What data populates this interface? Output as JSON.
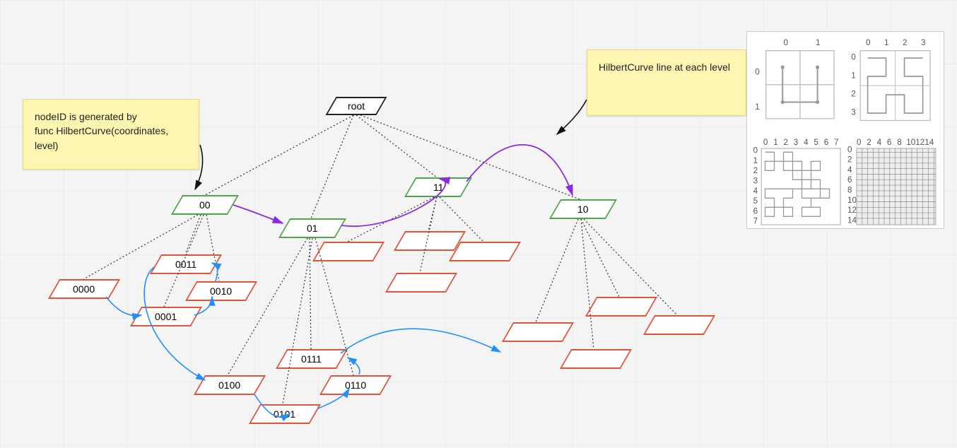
{
  "notes": {
    "left": {
      "line1": "nodeID is generated by",
      "line2": "func HilbertCurve(coordinates, level)"
    },
    "right": {
      "line1": "HilbertCurve line at each level"
    }
  },
  "nodes": {
    "root": "root",
    "l1": {
      "n00": "00",
      "n01": "01",
      "n11": "11",
      "n10": "10"
    },
    "l2": {
      "n0000": "0000",
      "n0011": "0011",
      "n0001": "0001",
      "n0010": "0010",
      "n0100": "0100",
      "n0111": "0111",
      "n0101": "0101",
      "n0110": "0110"
    }
  },
  "colors": {
    "black": "#222222",
    "green": "#4ea64e",
    "red": "#e0543a",
    "purple": "#8a2be2",
    "blue": "#1e90ff",
    "arrowBlack": "#111111"
  },
  "hilbert": {
    "quad1_labels": [
      "0",
      "1"
    ],
    "quad2_labels": [
      "0",
      "1",
      "2",
      "3"
    ],
    "quad3_labels": [
      "0",
      "1",
      "2",
      "3",
      "4",
      "5",
      "6",
      "7"
    ],
    "quad4_labels": [
      "0",
      "2",
      "4",
      "6",
      "8",
      "10",
      "12",
      "14"
    ]
  }
}
